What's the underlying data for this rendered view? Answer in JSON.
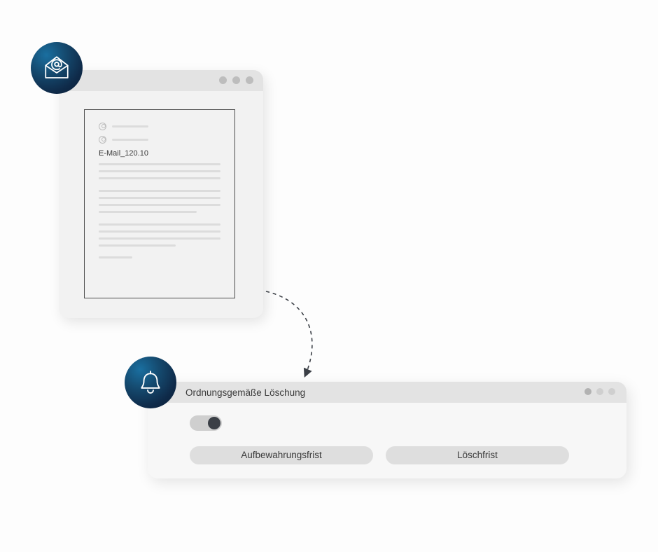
{
  "email_window": {
    "document": {
      "subject": "E-Mail_120.10"
    }
  },
  "deletion_panel": {
    "title": "Ordnungsgemäße Löschung",
    "toggle_on": true,
    "buttons": {
      "retention": "Aufbewahrungsfrist",
      "deletion_deadline": "Löschfrist"
    }
  },
  "icons": {
    "email": "email-at-envelope-icon",
    "bell": "bell-icon"
  }
}
